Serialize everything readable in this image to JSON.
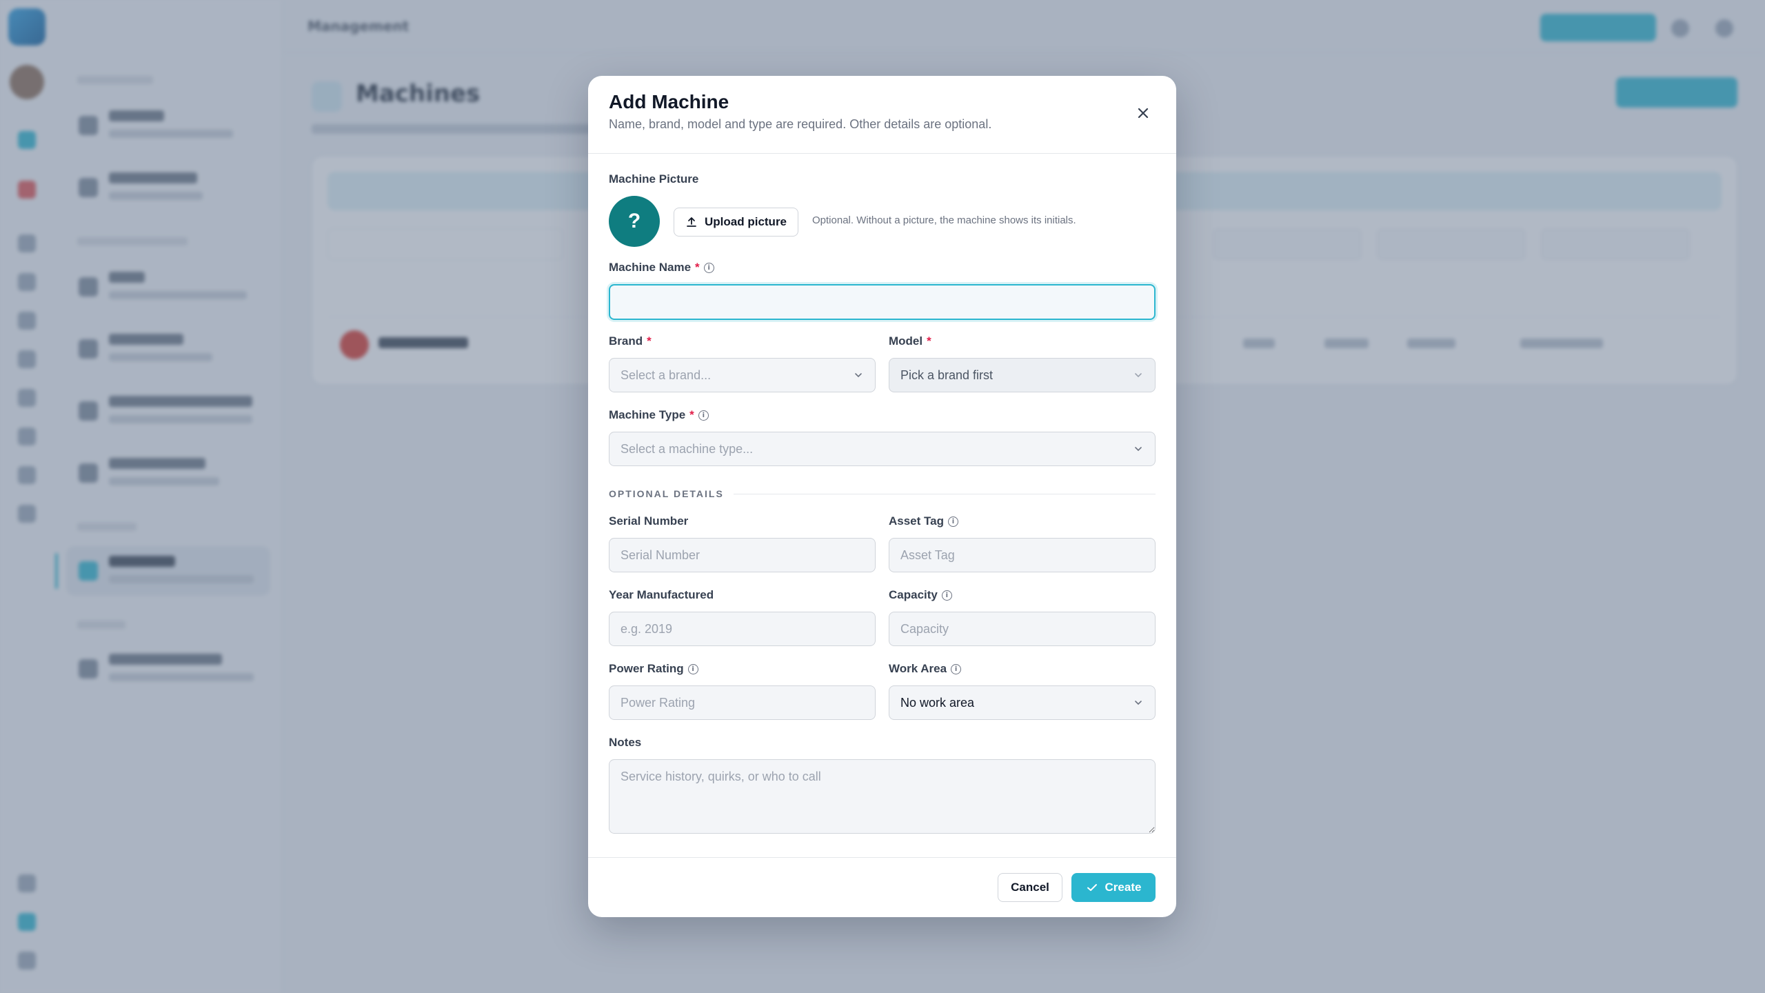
{
  "background": {
    "breadcrumb": "Management",
    "page_title": "Machines"
  },
  "modal": {
    "title": "Add Machine",
    "subtitle": "Name, brand, model and type are required. Other details are optional.",
    "picture": {
      "label": "Machine Picture",
      "placeholder_glyph": "?",
      "upload_label": "Upload picture",
      "hint": "Optional. Without a picture, the machine shows its initials."
    },
    "machine_name": {
      "label": "Machine Name",
      "required_mark": "*",
      "value": "",
      "placeholder": ""
    },
    "brand": {
      "label": "Brand",
      "required_mark": "*",
      "value": "Select a brand..."
    },
    "model": {
      "label": "Model",
      "required_mark": "*",
      "value": "Pick a brand first"
    },
    "machine_type": {
      "label": "Machine Type",
      "required_mark": "*",
      "value": "Select a machine type..."
    },
    "optional_section": "OPTIONAL DETAILS",
    "serial_number": {
      "label": "Serial Number",
      "placeholder": "Serial Number"
    },
    "asset_tag": {
      "label": "Asset Tag",
      "placeholder": "Asset Tag"
    },
    "year_manufactured": {
      "label": "Year Manufactured",
      "placeholder": "e.g. 2019"
    },
    "capacity": {
      "label": "Capacity",
      "placeholder": "Capacity"
    },
    "power_rating": {
      "label": "Power Rating",
      "placeholder": "Power Rating"
    },
    "work_area": {
      "label": "Work Area",
      "value": "No work area"
    },
    "notes": {
      "label": "Notes",
      "placeholder": "Service history, quirks, or who to call"
    },
    "cancel_label": "Cancel",
    "create_label": "Create"
  },
  "colors": {
    "accent": "#2bb6cf",
    "picture_bg": "#0f7d80",
    "required": "#e11d48"
  }
}
